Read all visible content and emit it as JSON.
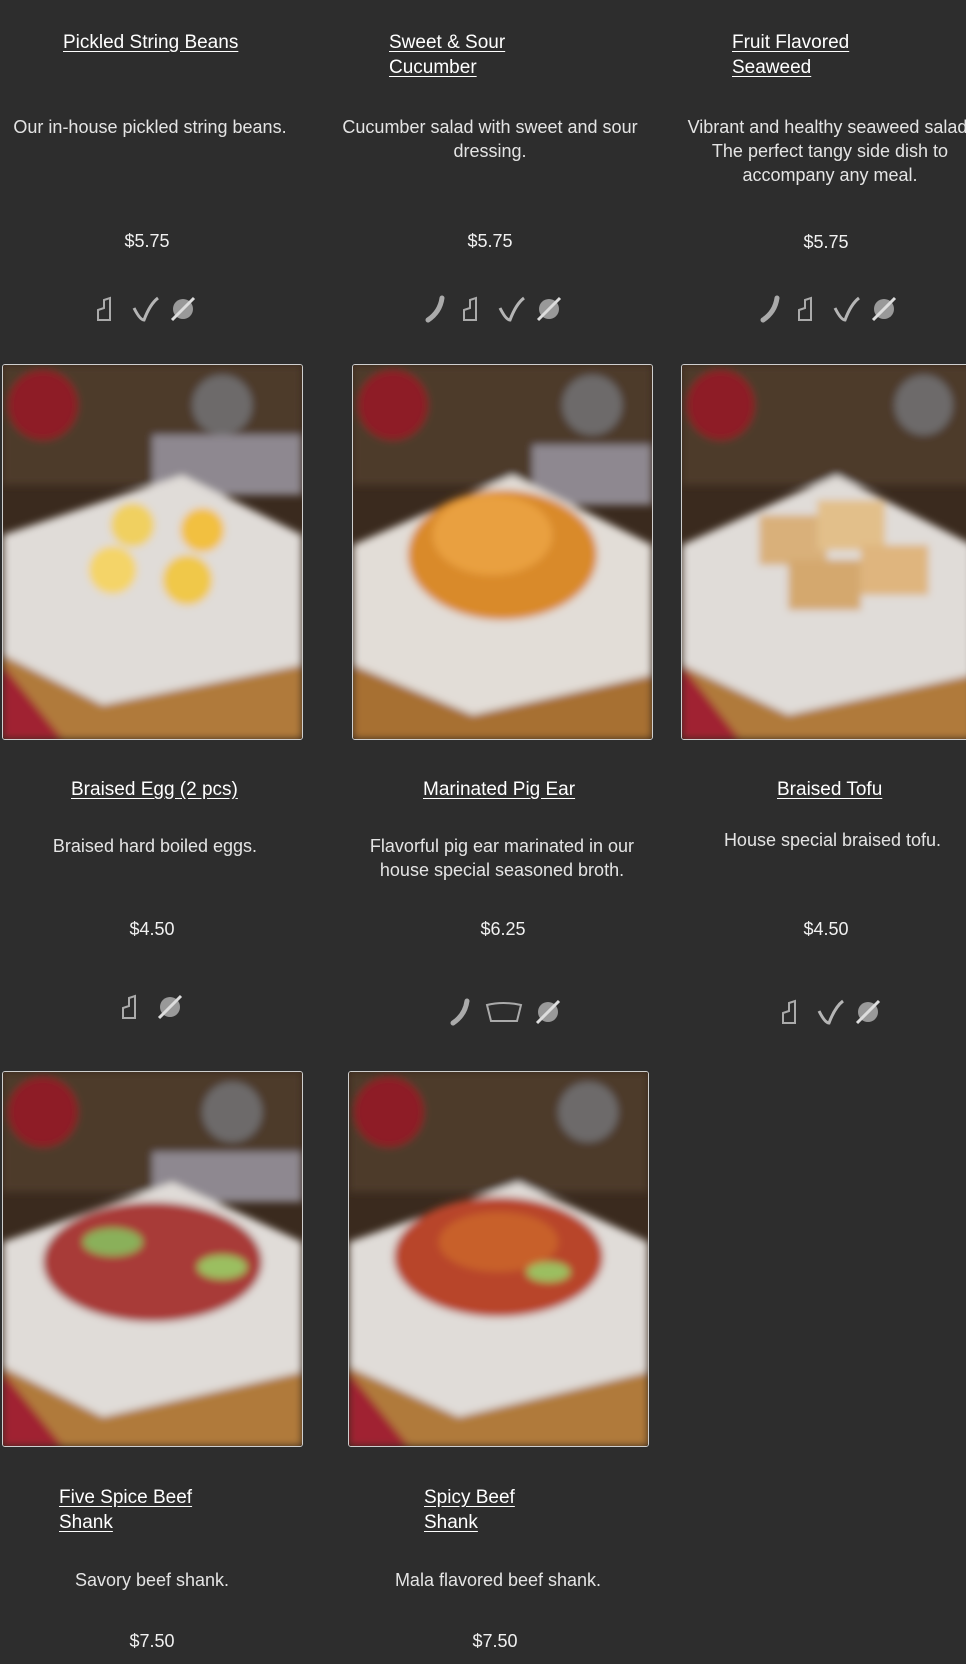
{
  "items": [
    {
      "name": "Pickled String Beans",
      "description": "Our in-house pickled string beans.",
      "price": "$5.75",
      "icons": [
        "vegan-icon",
        "leaf-icon",
        "gluten-free-icon"
      ]
    },
    {
      "name": "Sweet & Sour\nCucumber",
      "description": "Cucumber salad with sweet and sour dressing.",
      "price": "$5.75",
      "icons": [
        "spicy-icon",
        "vegan-icon",
        "leaf-icon",
        "gluten-free-icon"
      ]
    },
    {
      "name": "Fruit Flavored\nSeaweed",
      "description": "Vibrant and healthy seaweed salad. The perfect tangy side dish to accompany any meal.",
      "price": "$5.75",
      "icons": [
        "spicy-icon",
        "vegan-icon",
        "leaf-icon",
        "gluten-free-icon"
      ]
    },
    {
      "name": "Braised Egg (2 pcs)",
      "description": "Braised hard boiled eggs.",
      "price": "$4.50",
      "icons": [
        "vegan-icon",
        "gluten-free-icon"
      ],
      "photo": "egg"
    },
    {
      "name": "Marinated Pig Ear",
      "description": "Flavorful pig ear marinated in our house special seasoned broth.",
      "price": "$6.25",
      "icons": [
        "spicy-icon",
        "pig-icon",
        "gluten-free-icon"
      ],
      "photo": "pigear"
    },
    {
      "name": "Braised Tofu",
      "description": "House special braised tofu.",
      "price": "$4.50",
      "icons": [
        "vegan-icon",
        "leaf-icon",
        "gluten-free-icon"
      ],
      "photo": "tofu"
    },
    {
      "name": "Five Spice Beef\nShank",
      "description": "Savory beef shank.",
      "price": "$7.50",
      "photo": "beef"
    },
    {
      "name": "Spicy Beef\nShank",
      "description": "Mala flavored beef shank.",
      "price": "$7.50",
      "photo": "spicybeef"
    }
  ],
  "colors": {
    "background": "#2d2d2d",
    "text": "#e8e8e8",
    "title": "#ffffff"
  }
}
